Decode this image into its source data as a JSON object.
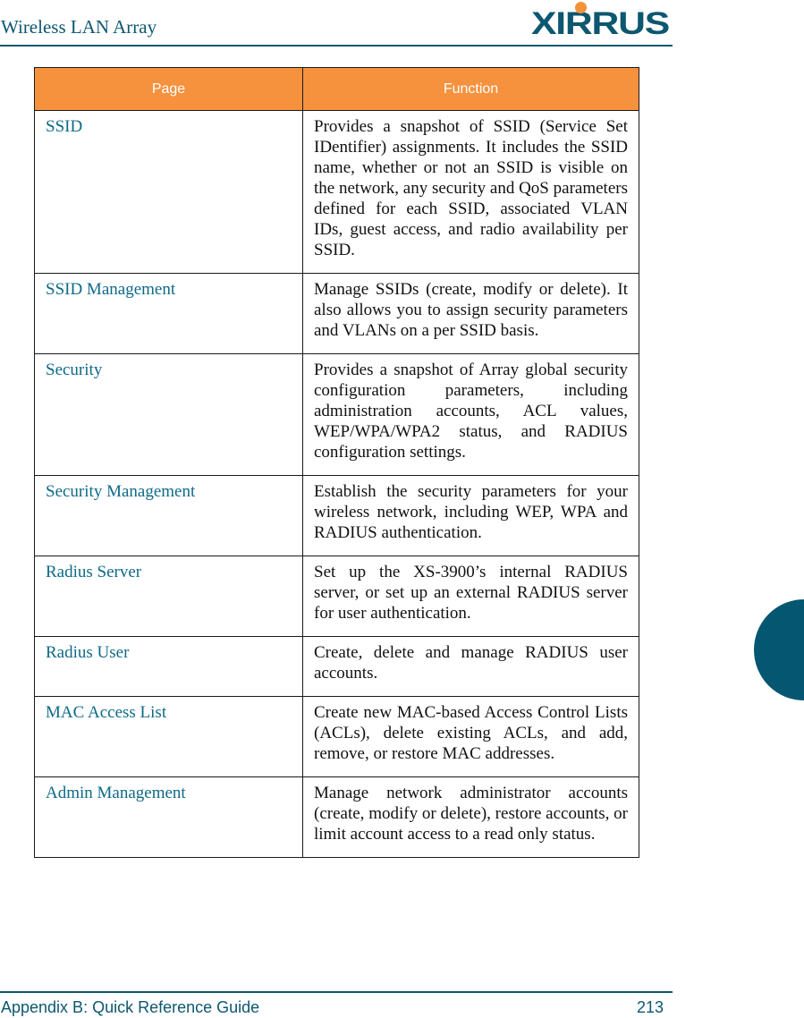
{
  "header": {
    "title": "Wireless LAN Array",
    "logo_text": "XIRRUS",
    "logo_icon": "xirrus-logo"
  },
  "table": {
    "columns": [
      "Page",
      "Function"
    ],
    "rows": [
      {
        "page": "SSID",
        "function": "Provides a snapshot of SSID (Service Set IDentifier) assignments. It includes the SSID name, whether or not an SSID is visible on the network, any security and QoS parameters defined for each SSID, associated VLAN IDs, guest access, and radio availability per SSID."
      },
      {
        "page": "SSID Management",
        "function": "Manage SSIDs (create, modify or delete). It also allows you to assign security parameters and VLANs on a per SSID basis."
      },
      {
        "page": "Security",
        "function": "Provides a snapshot of Array global security configuration parameters, including administration accounts, ACL values, WEP/WPA/WPA2 status, and RADIUS configuration settings."
      },
      {
        "page": "Security Management",
        "function": "Establish the security parameters for your wireless network, including WEP, WPA and RADIUS authentication."
      },
      {
        "page": "Radius Server",
        "function": "Set up the XS-3900’s internal RADIUS server, or set up an external RADIUS server for user authentication."
      },
      {
        "page": "Radius User",
        "function": "Create, delete and manage RADIUS user accounts."
      },
      {
        "page": "MAC Access List",
        "function": "Create new MAC-based Access Control Lists (ACLs), delete existing ACLs, and add, remove, or restore MAC addresses."
      },
      {
        "page": "Admin Management",
        "function": "Manage network administrator accounts (create, modify or delete), restore accounts, or limit account access to a read only status."
      }
    ]
  },
  "footer": {
    "section": "Appendix B: Quick Reference Guide",
    "page_number": "213"
  },
  "colors": {
    "brand_teal": "#0d5770",
    "header_orange": "#f6923e",
    "link_teal": "#0d6a87"
  }
}
